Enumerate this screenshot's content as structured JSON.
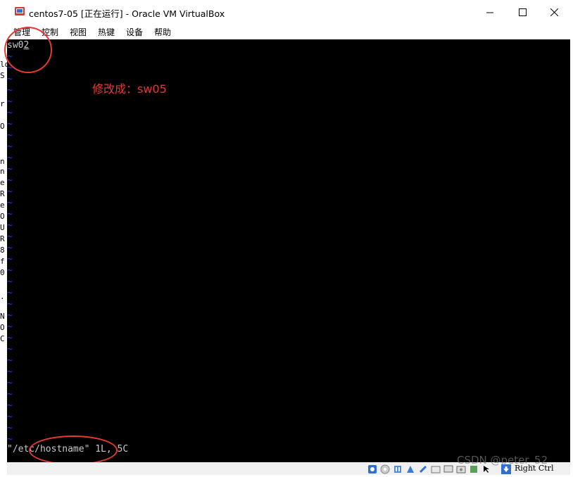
{
  "window": {
    "title": "centos7-05 [正在运行] - Oracle VM VirtualBox",
    "icon": "virtualbox-icon",
    "controls": {
      "minimize": "minimize-icon",
      "maximize": "maximize-icon",
      "close": "close-icon"
    }
  },
  "menu": {
    "items": [
      {
        "label": "管理"
      },
      {
        "label": "控制"
      },
      {
        "label": "视图"
      },
      {
        "label": "热键"
      },
      {
        "label": "设备"
      },
      {
        "label": "帮助"
      }
    ]
  },
  "terminal": {
    "first_line_prefix": "sw0",
    "first_line_cursor_char": "2",
    "tilde": "~",
    "status_line": "\"/etc/hostname\" 1L, 5C",
    "colors": {
      "background": "#000000",
      "tilde": "#1a3cf0",
      "text": "#c8c8c8"
    }
  },
  "annotation": {
    "text": "修改成：sw05",
    "color": "#e53935"
  },
  "left_bleed": {
    "chars": [
      "lo",
      "S",
      "r",
      "O",
      "n",
      "n",
      "e",
      "R",
      "e",
      "O",
      "U",
      "R",
      "8",
      "f",
      "0",
      ".",
      "N",
      "O",
      "C"
    ]
  },
  "statusbar": {
    "icons": [
      "hard-disk-icon",
      "optical-drive-icon",
      "audio-icon",
      "network-icon",
      "usb-icon",
      "shared-folder-icon",
      "display-icon",
      "recording-icon",
      "cpu-icon",
      "mouse-integration-icon"
    ],
    "host_key": "Right Ctrl"
  },
  "watermark": "CSDN @peter_52"
}
